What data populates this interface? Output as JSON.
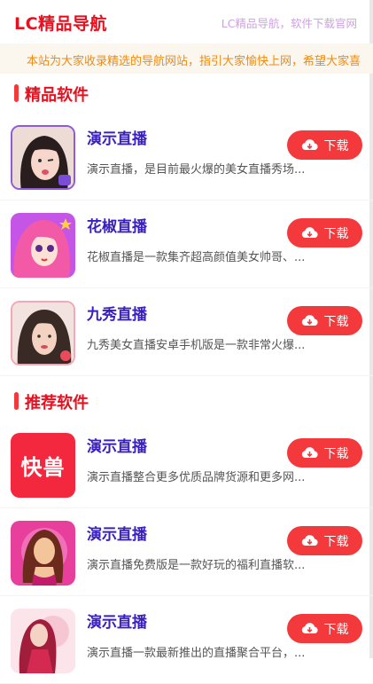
{
  "header": {
    "logo": "LC精品导航",
    "subtitle": "LC精品导航，软件下载官网"
  },
  "notice": "本站为大家收录精选的导航网站，指引大家愉快上网，希望大家喜",
  "sections": [
    {
      "title": "精品软件",
      "items": [
        {
          "name": "演示直播",
          "desc": "演示直播，是目前最火爆的美女直播秀场...",
          "button": "下载",
          "icon": "girl-portrait-icon"
        },
        {
          "name": "花椒直播",
          "desc": "花椒直播是一款集齐超高颜值美女帅哥、...",
          "button": "下载",
          "icon": "anime-girl-icon"
        },
        {
          "name": "九秀直播",
          "desc": "九秀美女直播安卓手机版是一款非常火爆...",
          "button": "下载",
          "icon": "woman-portrait-icon"
        }
      ]
    },
    {
      "title": "推荐软件",
      "items": [
        {
          "name": "演示直播",
          "desc": "演示直播整合更多优质品牌货源和更多网...",
          "button": "下载",
          "icon": "kuaishou-logo-icon",
          "icon_text": "快兽"
        },
        {
          "name": "演示直播",
          "desc": "演示直播免费版是一款好玩的福利直播软...",
          "button": "下载",
          "icon": "illustrated-woman-icon"
        },
        {
          "name": "演示直播",
          "desc": "演示直播一款最新推出的直播聚合平台，...",
          "button": "下载",
          "icon": "fashion-woman-icon"
        }
      ]
    }
  ],
  "colors": {
    "accent": "#f3393c",
    "logo": "#e8101f",
    "title": "#3a1fc0",
    "notice": "#f08a10"
  }
}
